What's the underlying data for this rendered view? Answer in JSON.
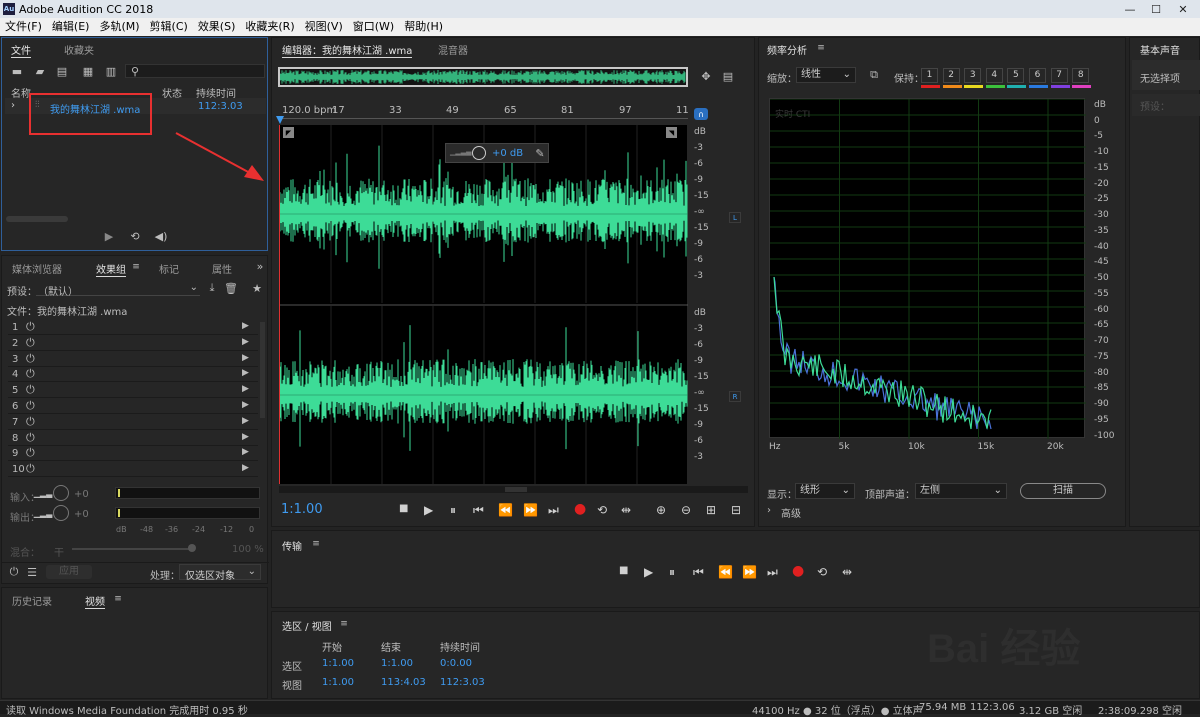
{
  "window": {
    "title": "Adobe Audition CC 2018",
    "app_icon": "Au",
    "min": "—",
    "max": "☐",
    "close": "✕"
  },
  "menu": [
    "文件(F)",
    "编辑(E)",
    "多轨(M)",
    "剪辑(C)",
    "效果(S)",
    "收藏夹(R)",
    "视图(V)",
    "窗口(W)",
    "帮助(H)"
  ],
  "files": {
    "tab_files": "文件",
    "tab_favorites": "收藏夹",
    "col_name": "名称",
    "col_status": "状态",
    "col_duration": "持续时间",
    "item_name": "我的舞林江湖 .wma",
    "item_duration": "112:3.03"
  },
  "effects": {
    "tabs": [
      "媒体浏览器",
      "效果组",
      "标记",
      "属性"
    ],
    "preset_label": "预设：",
    "preset_value": "（默认）",
    "file_label": "文件：我的舞林江湖 .wma",
    "slots": [
      "1",
      "2",
      "3",
      "4",
      "5",
      "6",
      "7",
      "8",
      "9",
      "10"
    ],
    "input_label": "输入：",
    "output_label": "输出：",
    "gain": "+0",
    "meter_ticks": [
      "dB",
      "-48",
      "-36",
      "-24",
      "-12",
      "0"
    ],
    "mix_label": "混合：",
    "mix_dry": "干",
    "mix_pct": "100 %",
    "apply_label": "应用",
    "process_label": "处理：",
    "process_value": "仅选区对象"
  },
  "history": {
    "tab_history": "历史记录",
    "tab_video": "视频"
  },
  "editor": {
    "tab_editor": "编辑器：我的舞林江湖 .wma",
    "tab_mixer": "混音器",
    "ruler": [
      "120.0 bpm",
      "17",
      "33",
      "49",
      "65",
      "81",
      "97",
      "11"
    ],
    "hud_gain": "+0 dB",
    "db_labels_L": [
      "dB",
      "-3",
      "-6",
      "-9",
      "-15",
      "-∞",
      "-15",
      "-9",
      "-6",
      "-3"
    ],
    "db_labels_R": [
      "dB",
      "-3",
      "-6",
      "-9",
      "-15",
      "-∞",
      "-15",
      "-9",
      "-6",
      "-3"
    ],
    "ch_L": "L",
    "ch_R": "R",
    "time": "1:1.00"
  },
  "freq": {
    "title": "频率分析",
    "zoom_label": "缩放：",
    "zoom_value": "线性",
    "hold_label": "保持：",
    "hold_slots": [
      "1",
      "2",
      "3",
      "4",
      "5",
      "6",
      "7",
      "8"
    ],
    "hold_colors": [
      "#e02020",
      "#f08a1a",
      "#e8d820",
      "#3cc03c",
      "#20b0b0",
      "#2a7ae0",
      "#8040e0",
      "#e040c0"
    ],
    "cti": "实时 CTI",
    "db_axis": [
      "dB",
      "0",
      "-5",
      "-10",
      "-15",
      "-20",
      "-25",
      "-30",
      "-35",
      "-40",
      "-45",
      "-50",
      "-55",
      "-60",
      "-65",
      "-70",
      "-75",
      "-80",
      "-85",
      "-90",
      "-95",
      "-100"
    ],
    "hz_axis": [
      "Hz",
      "5k",
      "10k",
      "15k",
      "20k"
    ],
    "display_label": "显示：",
    "display_value": "线形",
    "channel_label": "顶部声道：",
    "channel_value": "左侧",
    "scan_label": "扫描",
    "advanced_label": "高级"
  },
  "basic": {
    "title": "基本声音",
    "noselect": "无选择项",
    "preset": "预设："
  },
  "transport": {
    "title": "传输"
  },
  "selection": {
    "title": "选区 / 视图",
    "col_start": "开始",
    "col_end": "结束",
    "col_duration": "持续时间",
    "sel_label": "选区",
    "sel_start": "1:1.00",
    "sel_end": "1:1.00",
    "sel_dur": "0:0.00",
    "view_label": "视图",
    "view_start": "1:1.00",
    "view_end": "113:4.03",
    "view_dur": "112:3.03"
  },
  "status": {
    "left": "读取 Windows Media Foundation 完成用时 0.95 秒",
    "rate": "44100 Hz ● 32 位（浮点）● 立体声",
    "size": "75.94 MB",
    "dur": "112:3.06",
    "free": "3.12 GB 空闲",
    "time_free": "2:38:09.298 空闲"
  },
  "watermark": "Bai 经验",
  "colors": {
    "wave": "#3ddc97",
    "accent": "#3f9bf0",
    "record": "#e02020",
    "annotation": "#e83030"
  }
}
